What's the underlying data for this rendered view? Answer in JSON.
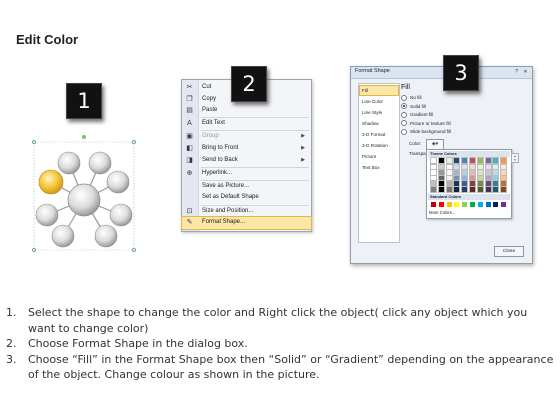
{
  "title": "Edit Color",
  "badges": [
    "1",
    "2",
    "3"
  ],
  "context_menu": {
    "items": [
      {
        "label": "Cut",
        "icon": "scissors-icon",
        "glyph": "✂",
        "enabled": true
      },
      {
        "label": "Copy",
        "icon": "copy-icon",
        "glyph": "❐",
        "enabled": true
      },
      {
        "label": "Paste",
        "icon": "paste-icon",
        "glyph": "▤",
        "enabled": true
      },
      {
        "label": "Edit Text",
        "icon": "edit-text-icon",
        "glyph": "A",
        "enabled": true
      },
      {
        "label": "Group",
        "icon": "group-icon",
        "glyph": "▣",
        "enabled": false,
        "submenu": true
      },
      {
        "label": "Bring to Front",
        "icon": "bring-front-icon",
        "glyph": "◧",
        "enabled": true,
        "submenu": true
      },
      {
        "label": "Send to Back",
        "icon": "send-back-icon",
        "glyph": "◨",
        "enabled": true,
        "submenu": true
      },
      {
        "label": "Hyperlink...",
        "icon": "hyperlink-icon",
        "glyph": "⊕",
        "enabled": true
      },
      {
        "label": "Save as Picture...",
        "icon": "",
        "glyph": "",
        "enabled": true
      },
      {
        "label": "Set as Default Shape",
        "icon": "",
        "glyph": "",
        "enabled": true
      },
      {
        "label": "Size and Position...",
        "icon": "size-position-icon",
        "glyph": "⊡",
        "enabled": true
      },
      {
        "label": "Format Shape...",
        "icon": "format-shape-icon",
        "glyph": "✎",
        "enabled": true,
        "highlighted": true
      }
    ],
    "submenu_arrow": "▶"
  },
  "dialog": {
    "title": "Format Shape",
    "controls": {
      "help": "?",
      "close": "✕"
    },
    "nav_items": [
      "Fill",
      "Line Color",
      "Line Style",
      "Shadow",
      "3-D Format",
      "3-D Rotation",
      "Picture",
      "Text Box"
    ],
    "selected_nav": "Fill",
    "heading": "Fill",
    "options": [
      "No fill",
      "Solid fill",
      "Gradient fill",
      "Picture or texture fill",
      "Slide background fill"
    ],
    "selected_option": "Solid fill",
    "color_label": "Color:",
    "transparency_label": "Transparency:",
    "transparency_label_visible": "Transpa",
    "palette": {
      "theme_heading": "Theme Colors",
      "theme_colors": [
        "#ffffff",
        "#000000",
        "#eeece1",
        "#1f497d",
        "#4f81bd",
        "#c0504d",
        "#9bbb59",
        "#8064a2",
        "#4bacc6",
        "#f79646"
      ],
      "standard_heading": "Standard Colors",
      "standard_colors": [
        "#c00000",
        "#ff0000",
        "#ffc000",
        "#ffff00",
        "#92d050",
        "#00b050",
        "#00b0f0",
        "#0070c0",
        "#002060",
        "#7030a0"
      ],
      "more_label": "More Colors..."
    },
    "close_label": "Close"
  },
  "shapes": {
    "highlight_color": "#f5c438",
    "circle_color": "#d9d9d9"
  },
  "instructions": [
    {
      "num": "1.",
      "text": "Select the shape to change the color and Right click the object( click any object which you want to change color)"
    },
    {
      "num": "2.",
      "text": "Choose Format Shape in the dialog box."
    },
    {
      "num": "3.",
      "text": "Choose “Fill” in the Format Shape box then “Solid” or “Gradient” depending on the appearance of the object. Change colour as shown in the picture."
    }
  ]
}
